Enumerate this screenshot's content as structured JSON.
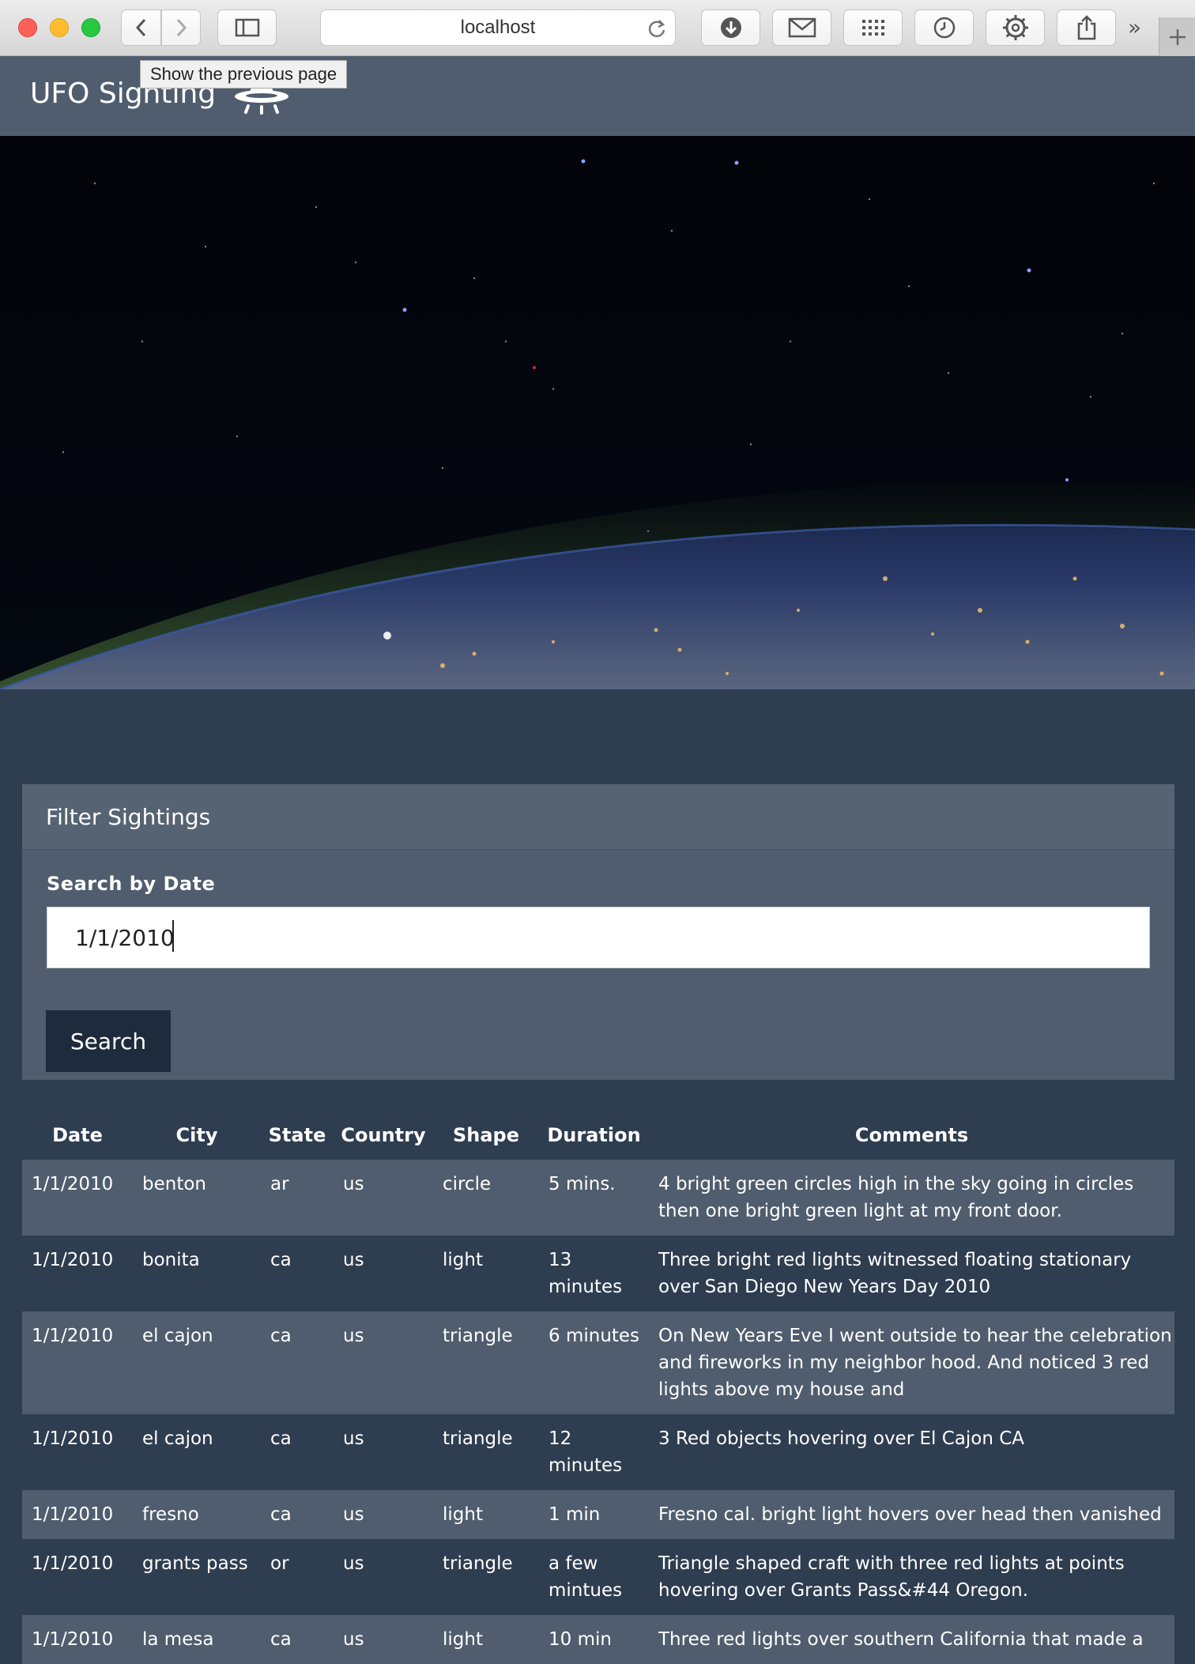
{
  "browser": {
    "address": "localhost",
    "tooltip": "Show the previous page",
    "more_glyph": "»"
  },
  "nav": {
    "brand": "UFO Sighting",
    "brand_icon": "ufo-icon"
  },
  "filter": {
    "title": "Filter Sightings",
    "label": "Search by Date",
    "value": "1/1/2010",
    "button": "Search"
  },
  "table": {
    "headers": [
      "Date",
      "City",
      "State",
      "Country",
      "Shape",
      "Duration",
      "Comments"
    ],
    "rows": [
      [
        "1/1/2010",
        "benton",
        "ar",
        "us",
        "circle",
        "5 mins.",
        "4 bright green circles high in the sky going in circles then one bright green light at my front door."
      ],
      [
        "1/1/2010",
        "bonita",
        "ca",
        "us",
        "light",
        "13 minutes",
        "Three bright red lights witnessed floating stationary over San Diego New Years Day 2010"
      ],
      [
        "1/1/2010",
        "el cajon",
        "ca",
        "us",
        "triangle",
        "6 minutes",
        "On New Years Eve I went outside to hear the celebration and fireworks in my neighbor hood. And noticed 3 red lights above my house and"
      ],
      [
        "1/1/2010",
        "el cajon",
        "ca",
        "us",
        "triangle",
        "12 minutes",
        "3 Red objects hovering over El Cajon CA"
      ],
      [
        "1/1/2010",
        "fresno",
        "ca",
        "us",
        "light",
        "1 min",
        "Fresno cal. bright light hovers over head then vanished"
      ],
      [
        "1/1/2010",
        "grants pass",
        "or",
        "us",
        "triangle",
        "a few mintues",
        "Triangle shaped craft with three red lights at points hovering over Grants Pass&#44 Oregon."
      ],
      [
        "1/1/2010",
        "la mesa",
        "ca",
        "us",
        "light",
        "10 min",
        "Three red lights over southern California that made a"
      ]
    ]
  }
}
